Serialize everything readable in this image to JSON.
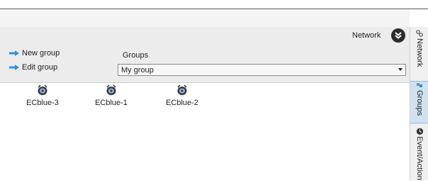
{
  "toolbar": {
    "new_group": "New group",
    "edit_group": "Edit group",
    "groups_label": "Groups",
    "network_label": "Network"
  },
  "group_select": {
    "value": "My group"
  },
  "devices": [
    {
      "name": "ECblue-3",
      "icon": "ecblue-device-icon"
    },
    {
      "name": "ECblue-1",
      "icon": "ecblue-device-icon"
    },
    {
      "name": "ECblue-2",
      "icon": "ecblue-device-icon"
    }
  ],
  "side_tabs": [
    {
      "label": "Network",
      "icon": "network-icon",
      "selected": false
    },
    {
      "label": "Groups",
      "icon": "groups-icon",
      "selected": true
    },
    {
      "label": "Event/Action",
      "icon": "event-icon",
      "selected": false
    }
  ],
  "colors": {
    "accent": "#2f8fd6",
    "selected_tab": "#cfe2f1",
    "panel": "#ececec"
  }
}
